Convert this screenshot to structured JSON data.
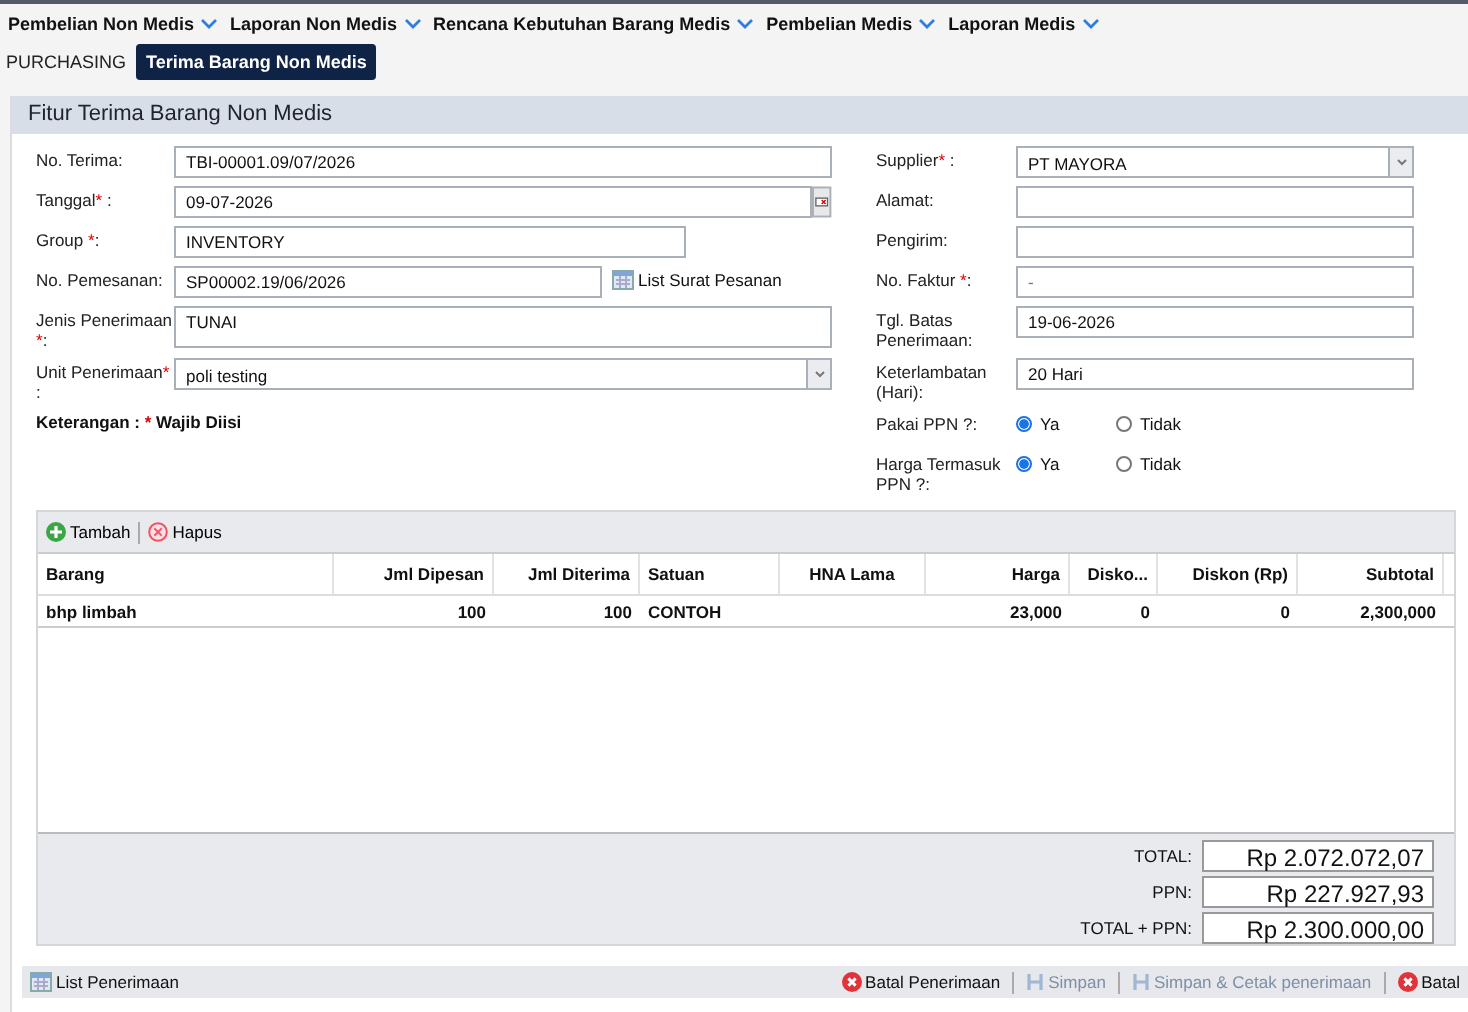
{
  "menu": [
    {
      "label": "Pembelian Non Medis"
    },
    {
      "label": "Laporan Non Medis"
    },
    {
      "label": "Rencana Kebutuhan Barang Medis"
    },
    {
      "label": "Pembelian Medis"
    },
    {
      "label": "Laporan Medis"
    }
  ],
  "breadcrumb": [
    {
      "label": "PURCHASING",
      "selected": false
    },
    {
      "label": "Terima Barang Non Medis",
      "selected": true
    }
  ],
  "panel_title": "Fitur Terima Barang Non Medis",
  "left_fields": [
    {
      "label": "No. Terima",
      "required": false,
      "suffix": ":",
      "kind": "text",
      "value": "TBI-00001.09/07/2026"
    },
    {
      "label": "Tanggal",
      "required": true,
      "suffix": " :",
      "kind": "date",
      "value": "09-07-2026"
    },
    {
      "label": "Group ",
      "required": true,
      "suffix": ":",
      "kind": "short",
      "value": "INVENTORY"
    },
    {
      "label": "No. Pemesanan",
      "required": false,
      "suffix": ":",
      "kind": "lookup",
      "value": "SP00002.19/06/2026",
      "link": "List Surat Pesanan"
    },
    {
      "label": "Jenis Penerimaan ",
      "required": true,
      "suffix": ":",
      "kind": "tall",
      "value": "TUNAI"
    },
    {
      "label": "Unit Penerimaan",
      "required": true,
      "suffix": " :",
      "kind": "select",
      "value": "poli testing"
    }
  ],
  "note": {
    "label": "Keterangan : ",
    "mark": "*",
    "text": " Wajib Diisi"
  },
  "right_fields": [
    {
      "label": "Supplier",
      "required": true,
      "suffix": " :",
      "kind": "select",
      "value": "PT MAYORA"
    },
    {
      "label": "Alamat",
      "required": false,
      "suffix": ":",
      "kind": "text"
    },
    {
      "label": "Pengirim",
      "required": false,
      "suffix": ":",
      "kind": "text"
    },
    {
      "label": "No. Faktur ",
      "required": true,
      "suffix": ":",
      "kind": "text",
      "placeholder": "-"
    },
    {
      "label": "Tgl. Batas Penerimaan",
      "required": false,
      "suffix": ":",
      "kind": "text",
      "value": "19-06-2026"
    },
    {
      "label": "Keterlambatan (Hari)",
      "required": false,
      "suffix": ":",
      "kind": "text",
      "value": "20 Hari"
    },
    {
      "label": "Pakai PPN ?",
      "required": false,
      "suffix": ":",
      "kind": "radio",
      "options": [
        {
          "label": "Ya",
          "selected": true
        },
        {
          "label": "Tidak",
          "selected": false
        }
      ]
    },
    {
      "label": "Harga Termasuk PPN ?",
      "required": false,
      "suffix": ":",
      "kind": "radio",
      "options": [
        {
          "label": "Ya",
          "selected": true
        },
        {
          "label": "Tidak",
          "selected": false
        }
      ]
    }
  ],
  "grid_toolbar": [
    {
      "label": "Tambah",
      "kind": "add"
    },
    {
      "label": "Hapus",
      "kind": "remove"
    }
  ],
  "table": {
    "columns": [
      "Barang",
      "Jml Dipesan",
      "Jml Diterima",
      "Satuan",
      "HNA Lama",
      "Harga",
      "Disko...",
      "Diskon (Rp)",
      "Subtotal"
    ],
    "rows": [
      [
        "bhp limbah",
        "100",
        "100",
        "CONTOH",
        "",
        "23,000",
        "0",
        "0",
        "2,300,000"
      ]
    ]
  },
  "totals": [
    {
      "label": "TOTAL:",
      "value": "Rp 2.072.072,07"
    },
    {
      "label": "PPN:",
      "value": "Rp 227.927,93"
    },
    {
      "label": "TOTAL + PPN:",
      "value": "Rp 2.300.000,00"
    }
  ],
  "footer_left": {
    "label": "List Penerimaan"
  },
  "footer_buttons": [
    {
      "label": "Batal Penerimaan",
      "kind": "cancel",
      "disabled": false
    },
    {
      "label": "Simpan",
      "kind": "save",
      "disabled": true
    },
    {
      "label": "Simpan & Cetak penerimaan",
      "kind": "save",
      "disabled": true
    },
    {
      "label": "Batal",
      "kind": "cancel",
      "disabled": false
    }
  ]
}
